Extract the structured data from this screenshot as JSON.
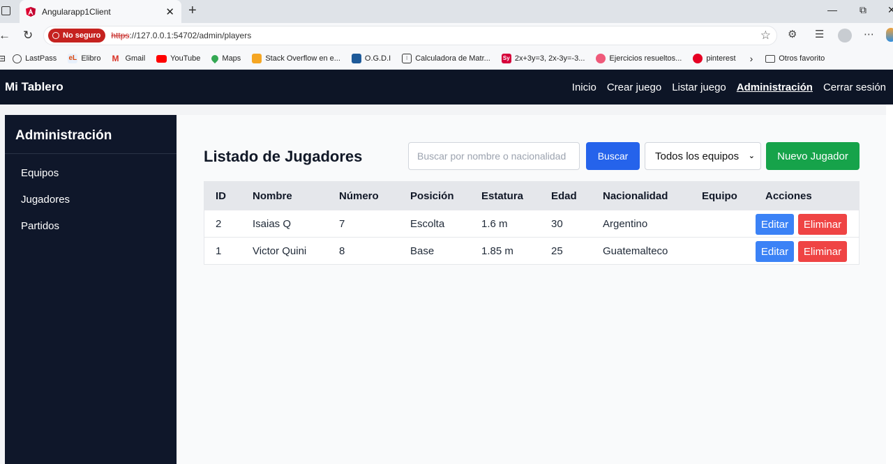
{
  "browser": {
    "tab_title": "Angularapp1Client",
    "not_secure_label": "No seguro",
    "url_scheme": "https",
    "url_rest": "://127.0.0.1:54702/admin/players",
    "bookmarks": [
      "LastPass",
      "Elibro",
      "Gmail",
      "YouTube",
      "Maps",
      "Stack Overflow en e...",
      "O.G.D.I",
      "Calculadora de Matr...",
      "2x+3y=3, 2x-3y=-3...",
      "Ejercicios resueltos...",
      "pinterest",
      "Otros favorito"
    ]
  },
  "navbar": {
    "brand": "Mi Tablero",
    "links": [
      "Inicio",
      "Crear juego",
      "Listar juego",
      "Administración",
      "Cerrar sesión"
    ]
  },
  "sidebar": {
    "title": "Administración",
    "items": [
      "Equipos",
      "Jugadores",
      "Partidos"
    ]
  },
  "main": {
    "title": "Listado de Jugadores",
    "search_placeholder": "Buscar por nombre o nacionalidad",
    "search_button": "Buscar",
    "team_filter": "Todos los equipos",
    "new_button": "Nuevo Jugador",
    "columns": [
      "ID",
      "Nombre",
      "Número",
      "Posición",
      "Estatura",
      "Edad",
      "Nacionalidad",
      "Equipo",
      "Acciones"
    ],
    "rows": [
      {
        "id": "2",
        "nombre": "Isaias Q",
        "numero": "7",
        "posicion": "Escolta",
        "estatura": "1.6 m",
        "edad": "30",
        "nacionalidad": "Argentino",
        "equipo": ""
      },
      {
        "id": "1",
        "nombre": "Victor Quini",
        "numero": "8",
        "posicion": "Base",
        "estatura": "1.85 m",
        "edad": "25",
        "nacionalidad": "Guatemalteco",
        "equipo": ""
      }
    ],
    "edit_label": "Editar",
    "delete_label": "Eliminar"
  }
}
